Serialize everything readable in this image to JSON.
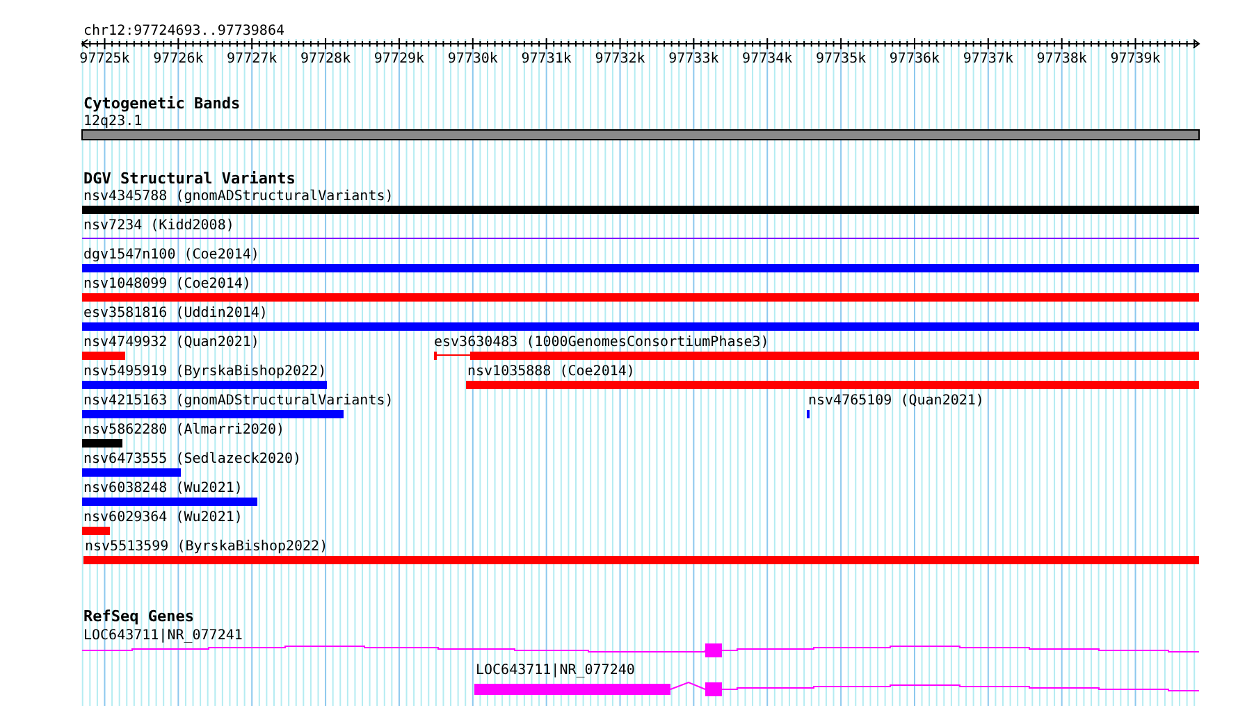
{
  "ruler": {
    "location": "chr12:97724693..97739864",
    "ticks": [
      "97725k",
      "97726k",
      "97727k",
      "97728k",
      "97729k",
      "97730k",
      "97731k",
      "97732k",
      "97733k",
      "97734k",
      "97735k",
      "97736k",
      "97737k",
      "97738k",
      "97739k"
    ]
  },
  "tracks": [
    {
      "title": "Cytogenetic Bands",
      "kind": "bands",
      "features": [
        {
          "label": "12q23.1"
        }
      ]
    },
    {
      "title": "DGV Structural Variants",
      "kind": "variants",
      "features": [
        {
          "label": "nsv4345788 (gnomADStructuralVariants)",
          "color": "#000000"
        },
        {
          "label": "nsv7234 (Kidd2008)",
          "color": "#8000ff"
        },
        {
          "label": "dgv1547n100 (Coe2014)",
          "color": "#0000ff"
        },
        {
          "label": "nsv1048099 (Coe2014)",
          "color": "#ff0000"
        },
        {
          "label": "esv3581816 (Uddin2014)",
          "color": "#0000ff"
        },
        {
          "label": "nsv4749932 (Quan2021)",
          "color": "#ff0000"
        },
        {
          "label": "esv3630483 (1000GenomesConsortiumPhase3)",
          "color": "#ff0000"
        },
        {
          "label": "nsv5495919 (ByrskaBishop2022)",
          "color": "#0000ff"
        },
        {
          "label": "nsv1035888 (Coe2014)",
          "color": "#ff0000"
        },
        {
          "label": "nsv4215163 (gnomADStructuralVariants)",
          "color": "#0000ff"
        },
        {
          "label": "nsv4765109 (Quan2021)",
          "color": "#0000ff"
        },
        {
          "label": "nsv5862280 (Almarri2020)",
          "color": "#000000"
        },
        {
          "label": "nsv6473555 (Sedlazeck2020)",
          "color": "#0000ff"
        },
        {
          "label": "nsv6038248 (Wu2021)",
          "color": "#0000ff"
        },
        {
          "label": "nsv6029364 (Wu2021)",
          "color": "#ff0000"
        },
        {
          "label": "nsv5513599 (ByrskaBishop2022)",
          "color": "#ff0000"
        }
      ]
    },
    {
      "title": "RefSeq Genes",
      "kind": "genes",
      "features": [
        {
          "label": "LOC643711|NR_077241"
        },
        {
          "label": "LOC643711|NR_077240"
        }
      ]
    }
  ]
}
